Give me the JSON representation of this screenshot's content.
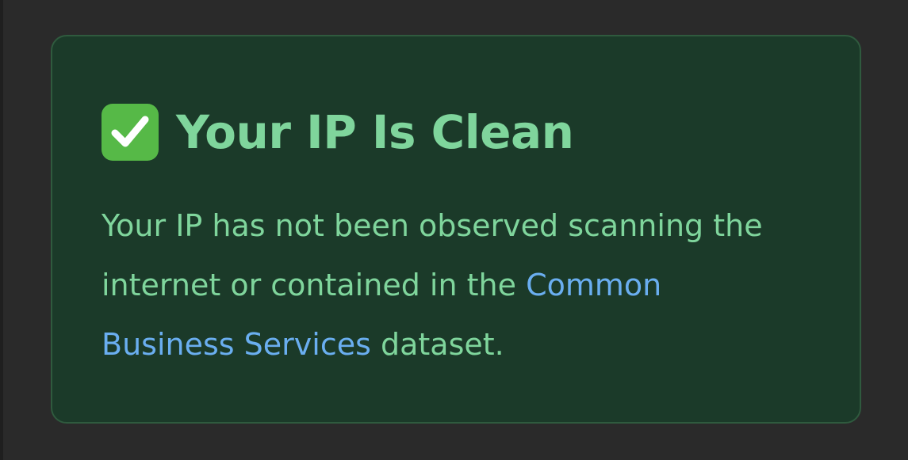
{
  "card": {
    "icon": "check-mark-button-icon",
    "title": "Your IP Is Clean",
    "message": {
      "part1": "Your IP has not been observed scanning the internet or contained in the ",
      "link_text": "Common Business Services",
      "part2": " dataset."
    }
  },
  "colors": {
    "background": "#2a2a2a",
    "card_background": "#1b3a29",
    "card_border": "#2f5a3e",
    "text_green": "#7fd59c",
    "link_blue": "#6aaef0",
    "check_green": "#56b947"
  }
}
